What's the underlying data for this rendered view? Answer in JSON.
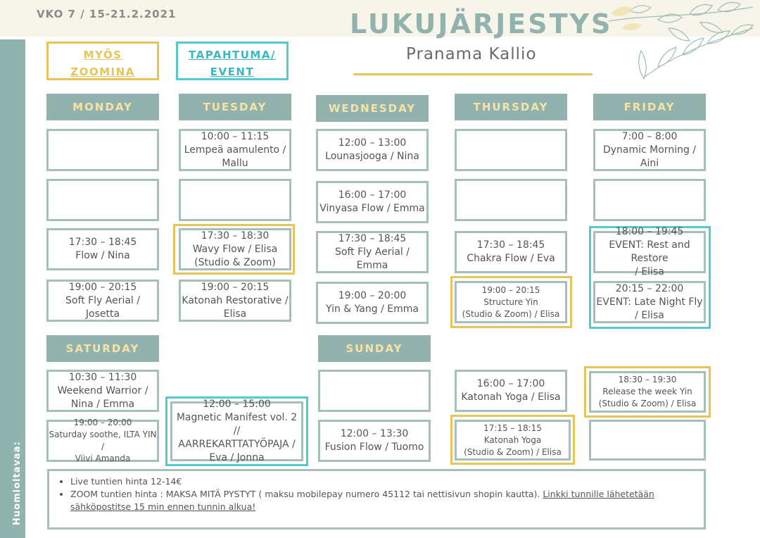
{
  "week_label": "VKO 7 / 15-21.2.2021",
  "title": "LUKUJÄRJESTYS",
  "subtitle": "Pranama Kallio",
  "sidebar_label": "Huomioitavaa:",
  "legend": {
    "zoom": "MYÖS\nZOOMINA",
    "event": "TAPAHTUMA/\nEVENT"
  },
  "colors": {
    "teal": "#91b2ad",
    "gold": "#e6c45a",
    "event": "#58c9d1",
    "day_text": "#f6e3a6"
  },
  "days": {
    "monday": "MONDAY",
    "tuesday": "TUESDAY",
    "wednesday": "WEDNESDAY",
    "thursday": "THURSDAY",
    "friday": "FRIDAY",
    "saturday": "SATURDAY",
    "sunday": "SUNDAY"
  },
  "slots": {
    "tue_1": "10:00 – 11:15\nLempeä aamulento /\nMallu",
    "wed_1": "12:00 – 13:00\nLounasjooga / Nina",
    "fri_1": "7:00 – 8:00\nDynamic Morning / Aini",
    "wed_2": "16:00 – 17:00\nVinyasa Flow / Emma",
    "mon_3": "17:30 – 18:45\nFlow / Nina",
    "tue_3": "17:30 – 18:30\nWavy Flow / Elisa\n(Studio & Zoom)",
    "wed_3": "17:30 – 18:45\nSoft Fly Aerial / Emma",
    "thu_3": "17:30 – 18:45\nChakra Flow / Eva",
    "fri_3": "18:00 – 19:45\nEVENT: Rest and Restore\n/ Elisa",
    "mon_4": "19:00 – 20:15\nSoft Fly Aerial / Josetta",
    "tue_4": "19:00 – 20:15\nKatonah Restorative /\nElisa",
    "wed_4": "19:00 – 20:00\nYin & Yang / Emma",
    "thu_4": "19:00 – 20:15\nStructure Yin\n(Studio & Zoom) / Elisa",
    "fri_4": "20:15 – 22:00\nEVENT: Late Night Fly\n/ Elisa",
    "sat_1": "10:30 – 11:30\nWeekend Warrior /\nNina / Emma",
    "sat_2": "19:00 – 20:00\nSaturday  soothe, ILTA YIN /\nViivi Amanda",
    "sat_event": "12:00 – 15:00\nMagnetic Manifest vol. 2 //\nAARREKARTTATYÖPAJA /\nEva / Jonna",
    "sun_2": "12:00 – 13:30\nFusion Flow / Tuomo",
    "thu_w1": "16:00 – 17:00\nKatonah Yoga / Elisa",
    "thu_w2": "17:15 – 18:15\nKatonah Yoga\n(Studio & Zoom) / Elisa",
    "fri_w1": "18:30 – 19:30\nRelease the week Yin\n(Studio & Zoom) / Elisa"
  },
  "notes": {
    "price": "Live tuntien hinta 12-14€",
    "zoom_text": "ZOOM tuntien hinta : MAKSA MITÄ PYSTYT ( maksu mobilepay numero 45112 tai nettisivun shopin kautta). ",
    "zoom_link": "Linkki tunnille lähetetään sähköpostitse 15 min ennen tunnin alkua!"
  }
}
